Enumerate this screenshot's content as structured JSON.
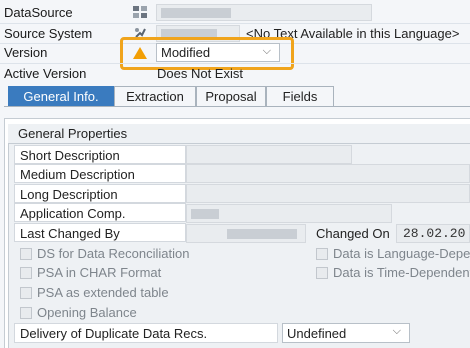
{
  "header": {
    "datasource_label": "DataSource",
    "source_system_label": "Source System",
    "source_system_text": "<No Text Available in this Language>",
    "version_label": "Version",
    "version_value": "Modified",
    "active_version_label": "Active Version",
    "active_version_value": "Does Not Exist"
  },
  "tabs": [
    {
      "label": "General Info."
    },
    {
      "label": "Extraction"
    },
    {
      "label": "Proposal"
    },
    {
      "label": "Fields"
    }
  ],
  "general_properties": {
    "title": "General Properties",
    "short_description_label": "Short Description",
    "medium_description_label": "Medium Description",
    "long_description_label": "Long Description",
    "application_comp_label": "Application Comp.",
    "last_changed_by_label": "Last Changed By",
    "changed_on_label": "Changed On",
    "changed_on_value": "28.02.20",
    "checkboxes": {
      "ds_for_reconciliation": "DS for Data Reconciliation",
      "psa_char_format": "PSA in CHAR Format",
      "psa_extended_table": "PSA as extended table",
      "opening_balance": "Opening Balance",
      "language_dependent": "Data is Language-Depend",
      "time_dependent": "Data is Time-Dependent"
    },
    "duplicate_records_label": "Delivery of Duplicate Data Recs.",
    "duplicate_records_value": "Undefined"
  },
  "colors": {
    "accent": "#3a7bbf",
    "highlight_outline": "#f0a41c",
    "warning_icon": "#f29f05"
  },
  "icons": {
    "datasource": "datasource-grid-icon",
    "source_system": "source-system-icon",
    "version_status": "warning-triangle-icon",
    "dropdown": "chevron-down-icon"
  }
}
